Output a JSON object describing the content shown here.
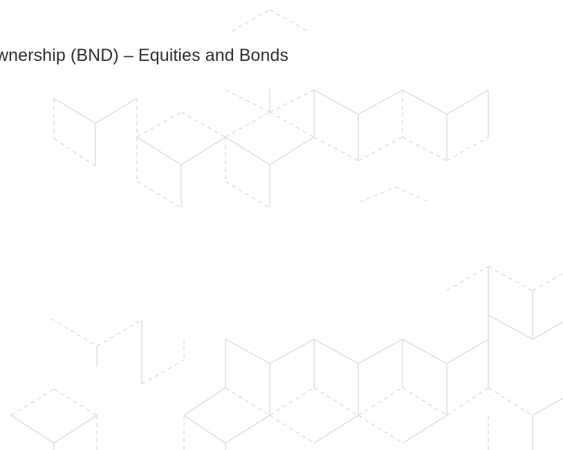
{
  "slide": {
    "title": "wnership (BND) – Equities and Bonds",
    "background_color": "#ffffff",
    "pattern_color": "#d6d6d6"
  }
}
